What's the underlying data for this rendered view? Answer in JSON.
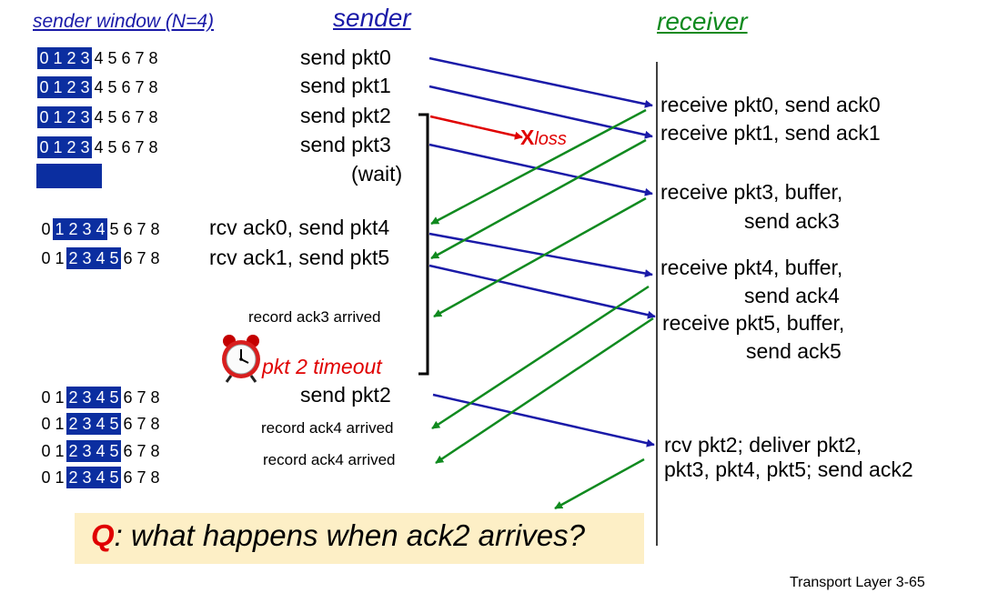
{
  "headers": {
    "sender_window": "sender window (N=4)",
    "sender": "sender",
    "receiver": "receiver"
  },
  "window_rows": [
    {
      "seq": [
        "0",
        "1",
        "2",
        "3",
        "4",
        "5",
        "6",
        "7",
        "8"
      ],
      "window": [
        0,
        1,
        2,
        3
      ]
    },
    {
      "seq": [
        "0",
        "1",
        "2",
        "3",
        "4",
        "5",
        "6",
        "7",
        "8"
      ],
      "window": [
        0,
        1,
        2,
        3
      ]
    },
    {
      "seq": [
        "0",
        "1",
        "2",
        "3",
        "4",
        "5",
        "6",
        "7",
        "8"
      ],
      "window": [
        0,
        1,
        2,
        3
      ]
    },
    {
      "seq": [
        "0",
        "1",
        "2",
        "3",
        "4",
        "5",
        "6",
        "7",
        "8"
      ],
      "window": [
        0,
        1,
        2,
        3
      ]
    },
    {
      "seq": [
        "0",
        "1",
        "2",
        "3",
        "4",
        "5",
        "6",
        "7",
        "8"
      ],
      "window": [
        1,
        2,
        3,
        4
      ]
    },
    {
      "seq": [
        "0",
        "1",
        "2",
        "3",
        "4",
        "5",
        "6",
        "7",
        "8"
      ],
      "window": [
        2,
        3,
        4,
        5
      ]
    },
    {
      "seq": [
        "0",
        "1",
        "2",
        "3",
        "4",
        "5",
        "6",
        "7",
        "8"
      ],
      "window": [
        2,
        3,
        4,
        5
      ]
    },
    {
      "seq": [
        "0",
        "1",
        "2",
        "3",
        "4",
        "5",
        "6",
        "7",
        "8"
      ],
      "window": [
        2,
        3,
        4,
        5
      ]
    },
    {
      "seq": [
        "0",
        "1",
        "2",
        "3",
        "4",
        "5",
        "6",
        "7",
        "8"
      ],
      "window": [
        2,
        3,
        4,
        5
      ]
    },
    {
      "seq": [
        "0",
        "1",
        "2",
        "3",
        "4",
        "5",
        "6",
        "7",
        "8"
      ],
      "window": [
        2,
        3,
        4,
        5
      ]
    }
  ],
  "sender_events": {
    "send_pkt0": "send  pkt0",
    "send_pkt1": "send  pkt1",
    "send_pkt2": "send  pkt2",
    "send_pkt3": "send  pkt3",
    "wait": "(wait)",
    "rcv_ack0": "rcv ack0, send pkt4",
    "rcv_ack1": "rcv ack1, send pkt5",
    "record_ack3": "record ack3 arrived",
    "timeout": "pkt 2 timeout",
    "resend_pkt2": "send  pkt2",
    "record_ack4_a": "record ack4 arrived",
    "record_ack4_b": "record ack4 arrived"
  },
  "loss": {
    "mark": "X",
    "text": "loss"
  },
  "receiver_events": {
    "r0": "receive pkt0, send ack0",
    "r1": "receive pkt1, send ack1",
    "r3a": "receive pkt3, buffer,",
    "r3b": "send ack3",
    "r4a": "receive pkt4, buffer,",
    "r4b": "send ack4",
    "r5a": "receive pkt5, buffer,",
    "r5b": "send ack5",
    "r2a": "rcv pkt2; deliver pkt2,",
    "r2b": "pkt3, pkt4, pkt5; send ack2"
  },
  "question": {
    "q": "Q",
    "text": ": what happens when ack2 arrives?"
  },
  "footer": "Transport Layer 3-65",
  "colors": {
    "data_arrow": "#1a1aa8",
    "ack_arrow": "#108a1f",
    "window": "#0b2ea0",
    "alert": "#e00000"
  },
  "icons": [
    "alarm-clock-icon"
  ]
}
